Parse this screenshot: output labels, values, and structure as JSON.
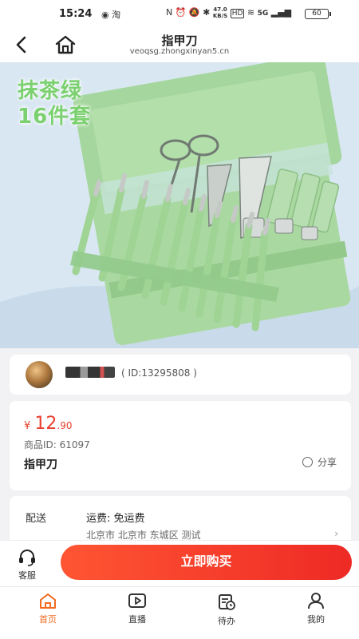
{
  "status_bar": {
    "time": "15:24",
    "app_icons": "◉  淘",
    "sys_icons": "N  ⏰  🔕  ✱",
    "net_speed_value": "47.0",
    "net_speed_unit": "KB/S",
    "hd": "HD",
    "signal": "5G",
    "battery": "60"
  },
  "nav": {
    "title": "指甲刀",
    "url": "veoqsg.zhongxinyan5.cn"
  },
  "hero": {
    "text_line1": "抹茶绿",
    "text_line2": "16件套"
  },
  "seller": {
    "id_text": "( ID:13295808 )"
  },
  "product": {
    "currency": "¥",
    "price_int": "12",
    "price_dec": ".90",
    "id_label": "商品ID: 61097",
    "name": "指甲刀",
    "share_label": "分享"
  },
  "delivery": {
    "label": "配送",
    "fee": "运费: 免运费",
    "address": "北京市 北京市 东城区 测试",
    "arrow": "›"
  },
  "actions": {
    "customer_service": "客服",
    "buy_now": "立即购买"
  },
  "tabs": [
    {
      "label": "首页",
      "icon": "home-icon",
      "active": true
    },
    {
      "label": "直播",
      "icon": "live-icon",
      "active": false
    },
    {
      "label": "待办",
      "icon": "todo-icon",
      "active": false
    },
    {
      "label": "我的",
      "icon": "profile-icon",
      "active": false
    }
  ],
  "colors": {
    "accent": "#f26b21",
    "price": "#e8402d",
    "buy_gradient_start": "#ff5533",
    "buy_gradient_end": "#ee2a25",
    "hero_text": "#7bd06f",
    "case_green": "#a9d8a1"
  }
}
